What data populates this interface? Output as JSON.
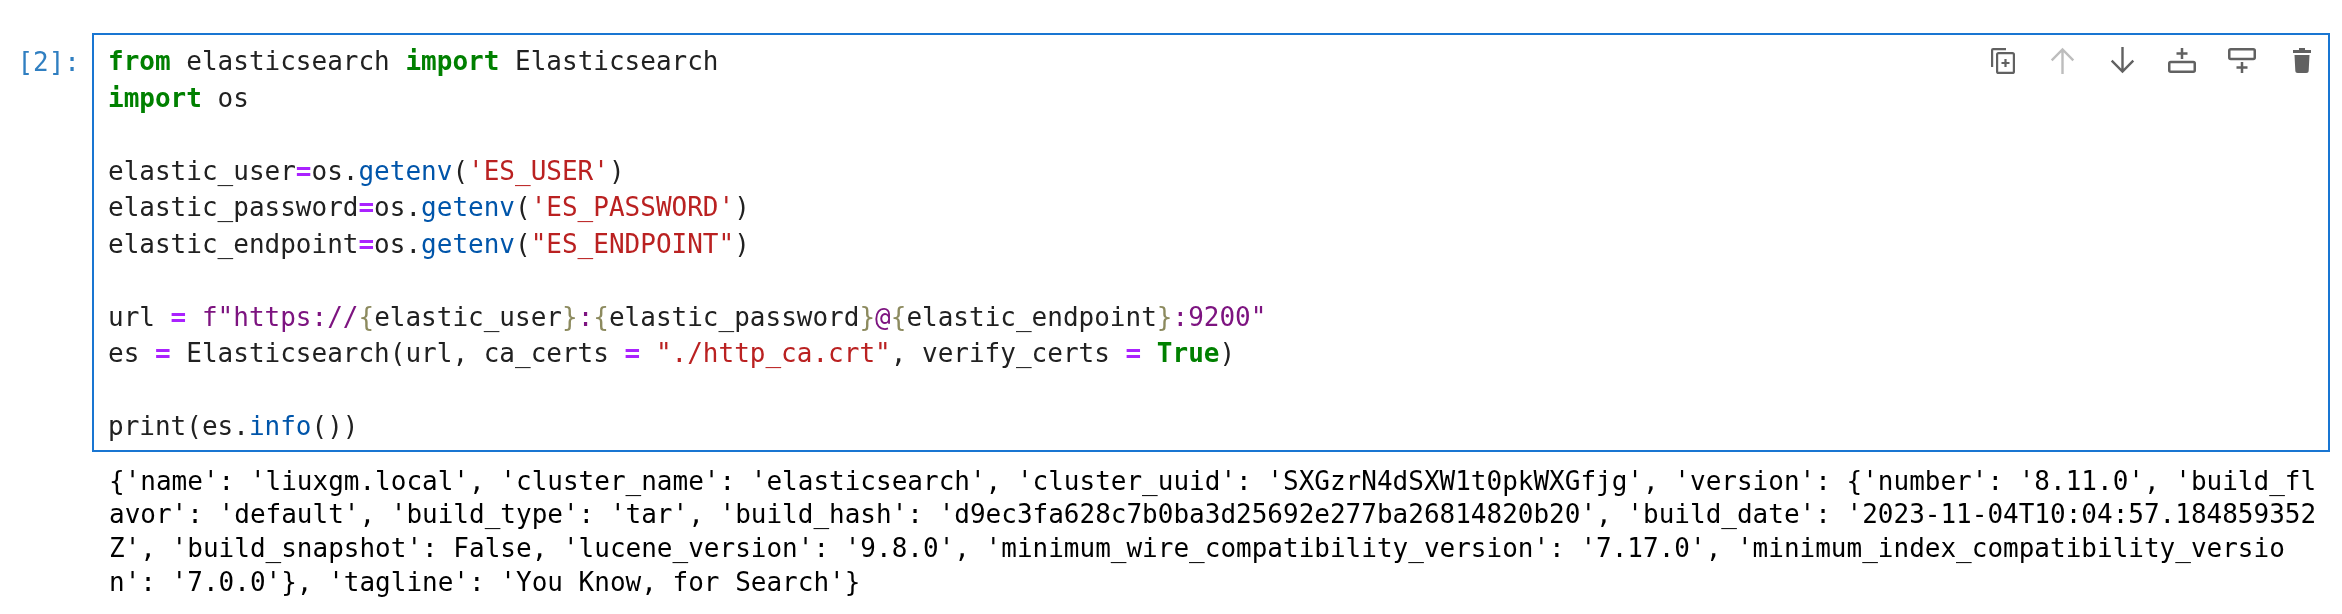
{
  "cell": {
    "prompt": "[2]:",
    "selected": true,
    "toolbar": [
      {
        "kind": "duplicate",
        "disabled": false
      },
      {
        "kind": "move-up",
        "disabled": true
      },
      {
        "kind": "move-down",
        "disabled": false
      },
      {
        "kind": "insert-above",
        "disabled": false
      },
      {
        "kind": "insert-below",
        "disabled": false
      },
      {
        "kind": "delete",
        "disabled": false
      }
    ],
    "code_blocks": [
      {
        "lines": [
          {
            "tokens": [
              {
                "kind": "keyword",
                "text": "from"
              },
              {
                "kind": "plain",
                "text": " elasticsearch "
              },
              {
                "kind": "keyword",
                "text": "import"
              },
              {
                "kind": "plain",
                "text": " Elasticsearch"
              }
            ]
          },
          {
            "tokens": [
              {
                "kind": "keyword",
                "text": "import"
              },
              {
                "kind": "plain",
                "text": " os"
              }
            ]
          }
        ]
      },
      {
        "lines": [
          {
            "tokens": [
              {
                "kind": "plain",
                "text": "elastic_user"
              },
              {
                "kind": "operator",
                "text": "="
              },
              {
                "kind": "plain",
                "text": "os."
              },
              {
                "kind": "call",
                "text": "getenv"
              },
              {
                "kind": "plain",
                "text": "("
              },
              {
                "kind": "string",
                "text": "'ES_USER'"
              },
              {
                "kind": "plain",
                "text": ")"
              }
            ]
          },
          {
            "tokens": [
              {
                "kind": "plain",
                "text": "elastic_password"
              },
              {
                "kind": "operator",
                "text": "="
              },
              {
                "kind": "plain",
                "text": "os."
              },
              {
                "kind": "call",
                "text": "getenv"
              },
              {
                "kind": "plain",
                "text": "("
              },
              {
                "kind": "string",
                "text": "'ES_PASSWORD'"
              },
              {
                "kind": "plain",
                "text": ")"
              }
            ]
          },
          {
            "tokens": [
              {
                "kind": "plain",
                "text": "elastic_endpoint"
              },
              {
                "kind": "operator",
                "text": "="
              },
              {
                "kind": "plain",
                "text": "os."
              },
              {
                "kind": "call",
                "text": "getenv"
              },
              {
                "kind": "plain",
                "text": "("
              },
              {
                "kind": "string",
                "text": "\"ES_ENDPOINT\""
              },
              {
                "kind": "plain",
                "text": ")"
              }
            ]
          }
        ]
      },
      {
        "lines": [
          {
            "tokens": [
              {
                "kind": "plain",
                "text": "url"
              },
              {
                "kind": "operator",
                "text": " = "
              },
              {
                "kind": "fstring",
                "text": "f\"https://"
              },
              {
                "kind": "brace",
                "text": "{"
              },
              {
                "kind": "plain",
                "text": "elastic_user"
              },
              {
                "kind": "brace",
                "text": "}"
              },
              {
                "kind": "fstring",
                "text": ":"
              },
              {
                "kind": "brace",
                "text": "{"
              },
              {
                "kind": "plain",
                "text": "elastic_password"
              },
              {
                "kind": "brace",
                "text": "}"
              },
              {
                "kind": "fstring",
                "text": "@"
              },
              {
                "kind": "brace",
                "text": "{"
              },
              {
                "kind": "plain",
                "text": "elastic_endpoint"
              },
              {
                "kind": "brace",
                "text": "}"
              },
              {
                "kind": "fstring",
                "text": ":9200\""
              }
            ]
          },
          {
            "tokens": [
              {
                "kind": "plain",
                "text": "es"
              },
              {
                "kind": "operator",
                "text": " = "
              },
              {
                "kind": "plain",
                "text": "Elasticsearch(url, ca_certs"
              },
              {
                "kind": "operator",
                "text": " = "
              },
              {
                "kind": "string",
                "text": "\"./http_ca.crt\""
              },
              {
                "kind": "plain",
                "text": ", verify_certs"
              },
              {
                "kind": "operator",
                "text": " = "
              },
              {
                "kind": "keyword",
                "text": "True"
              },
              {
                "kind": "plain",
                "text": ")"
              }
            ]
          }
        ]
      },
      {
        "lines": [
          {
            "tokens": [
              {
                "kind": "plain",
                "text": "print(es."
              },
              {
                "kind": "call",
                "text": "info"
              },
              {
                "kind": "plain",
                "text": "())"
              }
            ]
          }
        ]
      }
    ],
    "output": {
      "lines": [
        "{'name': 'liuxgm.local', 'cluster_name': 'elasticsearch', 'cluster_uuid': 'SXGzrN4dSXW1t0pkWXGfjg', 'version': {'number': '8.11.0', 'build_fl",
        "avor': 'default', 'build_type': 'tar', 'build_hash': 'd9ec3fa628c7b0ba3d25692e277ba26814820b20', 'build_date': '2023-11-04T10:04:57.184859352",
        "Z', 'build_snapshot': False, 'lucene_version': '9.8.0', 'minimum_wire_compatibility_version': '7.17.0', 'minimum_index_compatibility_versio",
        "n': '7.0.0'}, 'tagline': 'You Know, for Search'}"
      ]
    }
  }
}
